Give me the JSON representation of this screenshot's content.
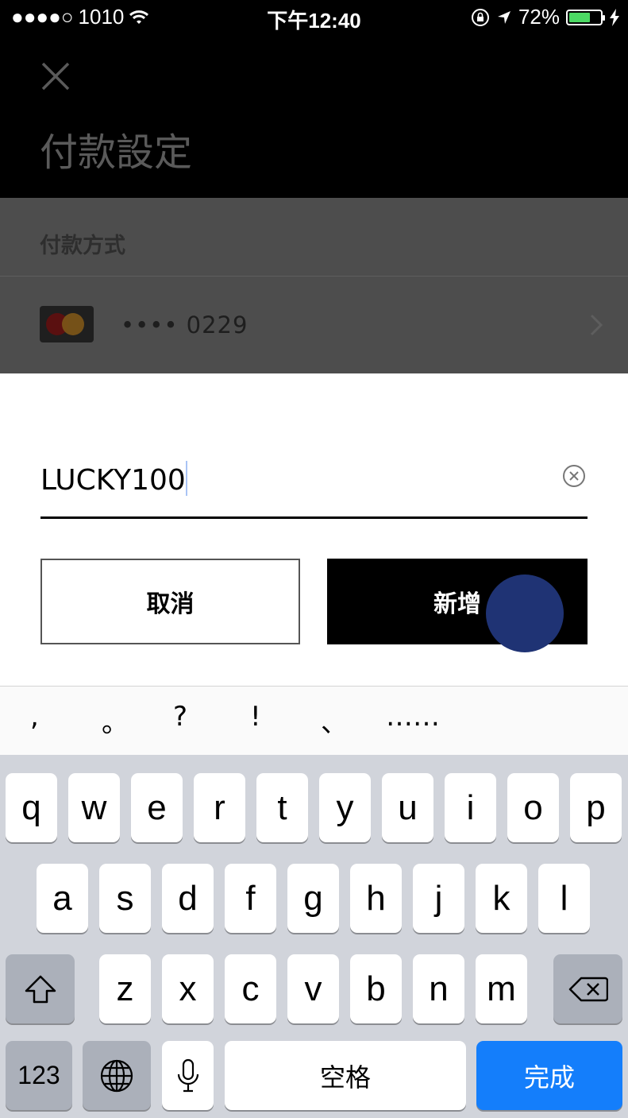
{
  "status_bar": {
    "signal": "●●●●○",
    "carrier": "1010",
    "time": "下午12:40",
    "battery_text": "72%",
    "battery_level": 0.72,
    "battery_color": "#4cd964"
  },
  "header": {
    "title": "付款設定"
  },
  "payment": {
    "section_label": "付款方式",
    "card_number": "•••• 0229"
  },
  "promo": {
    "value": "LUCKY100",
    "cancel_label": "取消",
    "add_label": "新增"
  },
  "suggestions": [
    ",",
    "。",
    "?",
    "!",
    "、",
    "……"
  ],
  "keyboard": {
    "row1": [
      "q",
      "w",
      "e",
      "r",
      "t",
      "y",
      "u",
      "i",
      "o",
      "p"
    ],
    "row2": [
      "a",
      "s",
      "d",
      "f",
      "g",
      "h",
      "j",
      "k",
      "l"
    ],
    "row3": [
      "z",
      "x",
      "c",
      "v",
      "b",
      "n",
      "m"
    ],
    "numbers_label": "123",
    "space_label": "空格",
    "done_label": "完成",
    "done_color": "#147efb"
  }
}
